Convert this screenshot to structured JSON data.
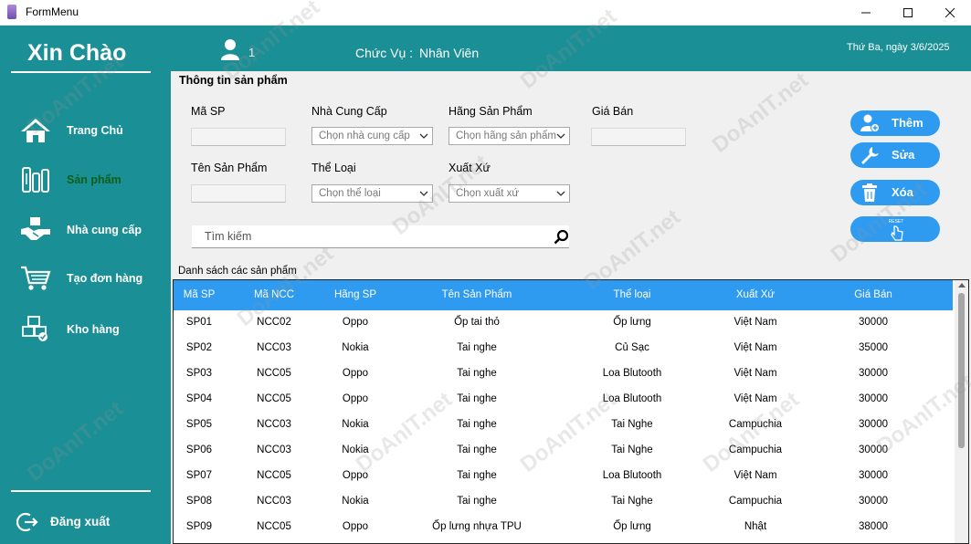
{
  "window": {
    "title": "FormMenu"
  },
  "sidebar": {
    "brand": "Xin Chào",
    "items": [
      {
        "label": "Trang Chủ",
        "icon": "home-icon"
      },
      {
        "label": "Sản phẩm",
        "icon": "usb-products-icon",
        "active": true
      },
      {
        "label": "Nhà cung cấp",
        "icon": "handshake-icon"
      },
      {
        "label": "Tạo đơn hàng",
        "icon": "cart-icon"
      },
      {
        "label": "Kho hàng",
        "icon": "boxes-icon"
      }
    ],
    "logout_label": "Đăng xuất"
  },
  "header": {
    "user_name": "1",
    "role_label": "Chức Vụ :",
    "role_value": "Nhân Viên",
    "date": "Thứ Ba, ngày 3/6/2025"
  },
  "form": {
    "group_title": "Thông tin sản phẩm",
    "labels": {
      "ma_sp": "Mã SP",
      "nha_cung_cap": "Nhà Cung Cấp",
      "hang_sp": "Hãng Sản Phẩm",
      "gia_ban": "Giá Bán",
      "ten_sp": "Tên Sản Phẩm",
      "the_loai": "Thể Loại",
      "xuat_xu": "Xuất Xứ"
    },
    "placeholders": {
      "nha_cung_cap": "Chọn nhà cung cấp",
      "hang_sp": "Chọn hãng sản phẩm",
      "the_loai": "Chọn thể loại",
      "xuat_xu": "Chọn xuất xứ"
    },
    "values": {
      "ma_sp": "",
      "gia_ban": "",
      "ten_sp": ""
    },
    "search_placeholder": "Tìm kiếm"
  },
  "actions": {
    "add_label": "Thêm",
    "edit_label": "Sửa",
    "delete_label": "Xóa",
    "reset_icon_text": "RESET"
  },
  "table": {
    "title": "Danh sách các sản phẩm",
    "columns": [
      "Mã SP",
      "Mã NCC",
      "Hãng SP",
      "Tên Sản Phẩm",
      "Thể loại",
      "Xuất Xứ",
      "Giá Bán"
    ],
    "rows": [
      [
        "SP01",
        "NCC02",
        "Oppo",
        "Ốp tai thỏ",
        "Ốp lưng",
        "Việt Nam",
        "30000"
      ],
      [
        "SP02",
        "NCC03",
        "Nokia",
        "Tai nghe",
        "Củ Sạc",
        "Việt Nam",
        "35000"
      ],
      [
        "SP03",
        "NCC05",
        "Oppo",
        "Tai nghe",
        "Loa Blutooth",
        "Việt Nam",
        "30000"
      ],
      [
        "SP04",
        "NCC05",
        "Oppo",
        "Tai nghe",
        "Loa Blutooth",
        "Việt Nam",
        "30000"
      ],
      [
        "SP05",
        "NCC03",
        "Nokia",
        "Tai nghe",
        "Tai Nghe",
        "Campuchia",
        "30000"
      ],
      [
        "SP06",
        "NCC03",
        "Nokia",
        "Tai nghe",
        "Tai Nghe",
        "Campuchia",
        "30000"
      ],
      [
        "SP07",
        "NCC05",
        "Oppo",
        "Tai nghe",
        "Loa Blutooth",
        "Việt Nam",
        "30000"
      ],
      [
        "SP08",
        "NCC03",
        "Nokia",
        "Tai nghe",
        "Tai Nghe",
        "Campuchia",
        "30000"
      ],
      [
        "SP09",
        "NCC05",
        "Oppo",
        "Ốp lưng nhựa TPU",
        "Ốp lưng",
        "Nhật",
        "38000"
      ]
    ]
  },
  "watermark": "DoAnIT.net",
  "colors": {
    "teal": "#1a8f96",
    "accent_blue": "#2e9bf0",
    "active_nav_text": "#0d5f17"
  }
}
